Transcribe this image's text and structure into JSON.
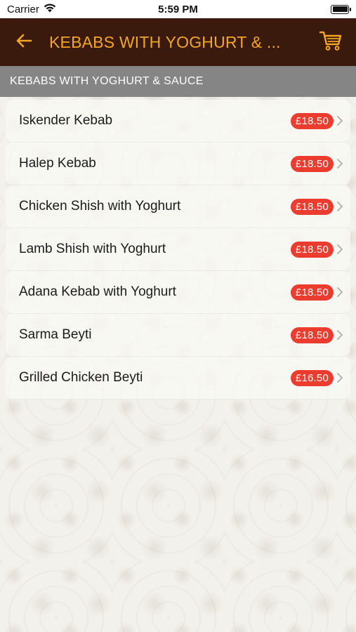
{
  "status_bar": {
    "carrier": "Carrier",
    "time": "5:59 PM"
  },
  "nav": {
    "title": "KEBABS WITH YOGHURT & ...",
    "accent_color": "#f2a623",
    "background_color": "#3a1a0d",
    "back_icon": "arrow-left-icon",
    "cart_icon": "cart-icon"
  },
  "section": {
    "title": "KEBABS WITH YOGHURT & SAUCE"
  },
  "items": [
    {
      "name": "Iskender Kebab",
      "price": "£18.50"
    },
    {
      "name": "Halep Kebab",
      "price": "£18.50"
    },
    {
      "name": "Chicken Shish with Yoghurt",
      "price": "£18.50"
    },
    {
      "name": "Lamb Shish with Yoghurt",
      "price": "£18.50"
    },
    {
      "name": "Adana Kebab with Yoghurt",
      "price": "£18.50"
    },
    {
      "name": "Sarma Beyti",
      "price": "£18.50"
    },
    {
      "name": "Grilled Chicken Beyti",
      "price": "£16.50"
    }
  ],
  "price_badge_color": "#ec3b2f"
}
